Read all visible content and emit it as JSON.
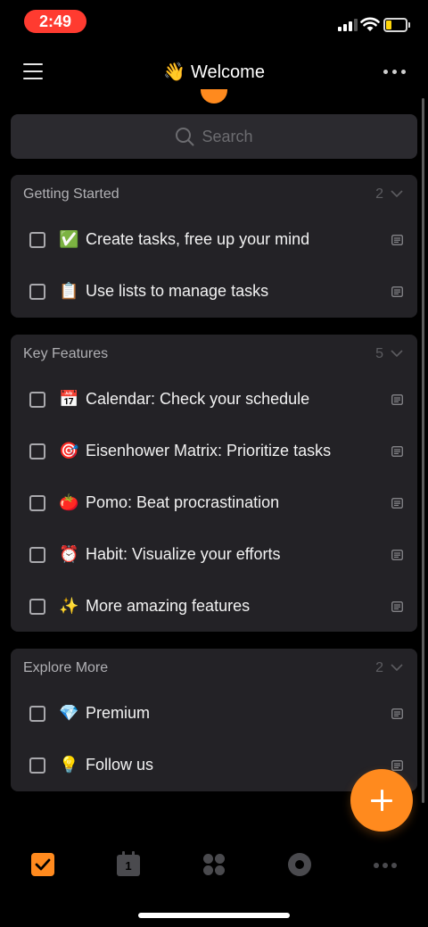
{
  "status_bar": {
    "time": "2:49",
    "time_pill_color": "#ff3b30",
    "battery_color": "#ffd60a"
  },
  "header": {
    "title_emoji": "👋",
    "title": "Welcome",
    "menu_icon": "hamburger-menu-icon",
    "more_icon": "more-horizontal-icon"
  },
  "search": {
    "placeholder": "Search",
    "icon": "search-icon"
  },
  "colors": {
    "accent": "#ff8a1e",
    "background": "#000000",
    "card": "#232226"
  },
  "sections": [
    {
      "title": "Getting Started",
      "count": "2",
      "tasks": [
        {
          "emoji": "✅",
          "label": "Create tasks, free up your mind"
        },
        {
          "emoji": "📋",
          "label": "Use lists to manage tasks"
        }
      ]
    },
    {
      "title": "Key Features",
      "count": "5",
      "tasks": [
        {
          "emoji": "📅",
          "label": "Calendar: Check your schedule"
        },
        {
          "emoji": "🎯",
          "label": "Eisenhower Matrix: Prioritize tasks"
        },
        {
          "emoji": "🍅",
          "label": "Pomo: Beat procrastination"
        },
        {
          "emoji": "⏰",
          "label": "Habit: Visualize your efforts"
        },
        {
          "emoji": "✨",
          "label": "More amazing features"
        }
      ]
    },
    {
      "title": "Explore More",
      "count": "2",
      "tasks": [
        {
          "emoji": "💎",
          "label": "Premium"
        },
        {
          "emoji": "💡",
          "label": "Follow us"
        }
      ]
    }
  ],
  "tab_bar": {
    "calendar_day": "1",
    "tabs": [
      "task-tab-icon",
      "calendar-tab-icon",
      "matrix-tab-icon",
      "pomo-tab-icon",
      "more-tab-icon"
    ]
  }
}
